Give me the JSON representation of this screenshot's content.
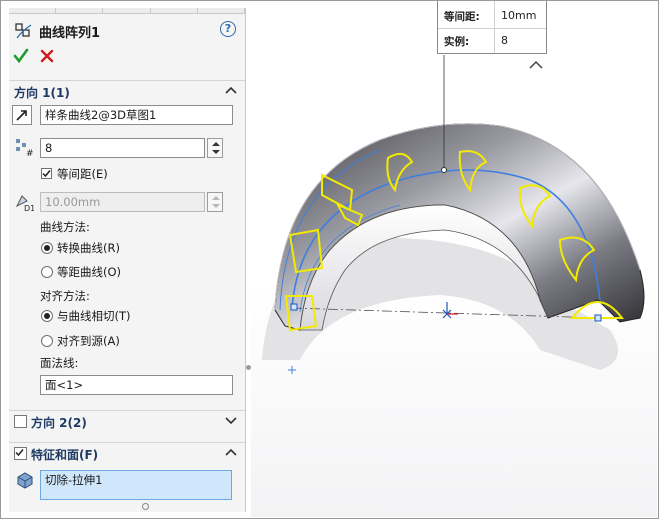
{
  "title": "曲线阵列1",
  "help_label": "?",
  "direction1": {
    "header": "方向 1(1)",
    "curve_field": "样条曲线2@3D草图1",
    "instances_value": "8",
    "equal_spacing_label": "等间距(E)",
    "equal_spacing_checked": true,
    "spacing_value": "10.00mm",
    "curve_method_label": "曲线方法:",
    "curve_method_options": [
      {
        "label": "转换曲线(R)",
        "selected": true
      },
      {
        "label": "等距曲线(O)",
        "selected": false
      }
    ],
    "alignment_label": "对齐方法:",
    "alignment_options": [
      {
        "label": "与曲线相切(T)",
        "selected": true
      },
      {
        "label": "对齐到源(A)",
        "selected": false
      }
    ],
    "face_label": "面法线:",
    "face_value": "面<1>"
  },
  "direction2": {
    "header": "方向 2(2)",
    "checked": false
  },
  "features": {
    "header": "特征和面(F)",
    "checked": true,
    "selected_item": "切除-拉伸1"
  },
  "callout": {
    "rows": [
      {
        "key": "等间距:",
        "value": "10mm"
      },
      {
        "key": "实例:",
        "value": "8"
      }
    ]
  },
  "colors": {
    "section_header": "#1f3a63",
    "ok_green": "#1e9a2e",
    "cancel_red": "#d11a1a",
    "pattern_preview_yellow": "#f2ea00",
    "curve_blue": "#3d7fe0",
    "selection_fill": "#cfe6fb"
  },
  "icons": [
    "curve-pattern-icon",
    "help-icon",
    "ok-check-icon",
    "cancel-x-icon",
    "pattern-direction-icon",
    "instances-icon",
    "spacing-icon",
    "feature-icon",
    "chevron-up-icon",
    "chevron-down-icon"
  ]
}
